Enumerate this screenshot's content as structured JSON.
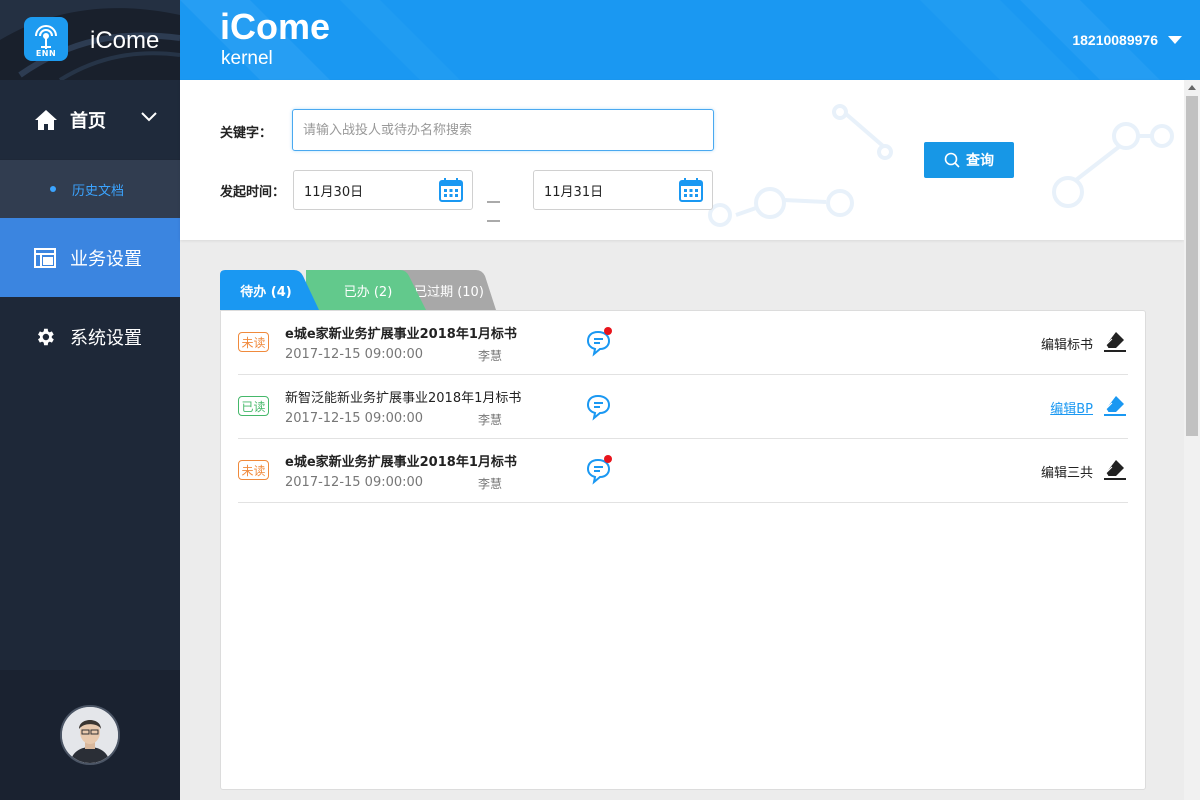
{
  "sidebar": {
    "brand_name": "iCome",
    "logo_text": "ENN",
    "nav": {
      "home_label": "首页",
      "history_label": "历史文档",
      "business_label": "业务设置",
      "system_label": "系统设置"
    }
  },
  "header": {
    "title": "iCome",
    "subtitle": "kernel",
    "user": "18210089976"
  },
  "search": {
    "keyword_label": "关键字：",
    "keyword_value": "",
    "keyword_placeholder": "请输入战投人或待办名称搜索",
    "time_label": "发起时间：",
    "start_date": "11月30日",
    "end_date": "11月31日",
    "query_label": "查询"
  },
  "tabs": [
    {
      "label": "待办 (4)",
      "color": "#1a98f2"
    },
    {
      "label": "已办 (2)",
      "color": "#62c98c"
    },
    {
      "label": "已过期 (10)",
      "color": "#a8a8a8"
    }
  ],
  "colors": {
    "accent": "#1a98f2",
    "unread": "#f08a3c",
    "read": "#45b86a",
    "notify_dot": "#e8141c"
  },
  "rows": [
    {
      "status": "未读",
      "title": "e城e家新业务扩展事业2018年1月标书",
      "date": "2017-12-15 09:00:00",
      "person": "李慧",
      "action": "编辑标书",
      "chat_icon": "chat-bubble-notify-icon"
    },
    {
      "status": "已读",
      "title": "新智泛能新业务扩展事业2018年1月标书",
      "date": "2017-12-15 09:00:00",
      "person": "李慧",
      "action": "编辑BP",
      "chat_icon": "chat-bubble-icon"
    },
    {
      "status": "未读",
      "title": "e城e家新业务扩展事业2018年1月标书",
      "date": "2017-12-15 09:00:00",
      "person": "李慧",
      "action": "编辑三共",
      "chat_icon": "chat-bubble-notify-icon"
    }
  ]
}
